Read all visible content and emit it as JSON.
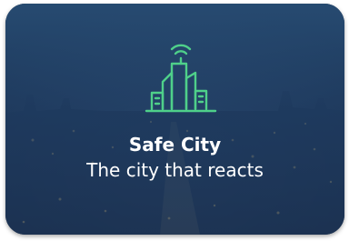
{
  "card": {
    "title": "Safe City",
    "subtitle": "The city that reacts",
    "icon": "smart-city-icon"
  },
  "colors": {
    "overlay": "#2a4d75",
    "icon_stroke": "#4fd08a",
    "text": "#ffffff"
  }
}
